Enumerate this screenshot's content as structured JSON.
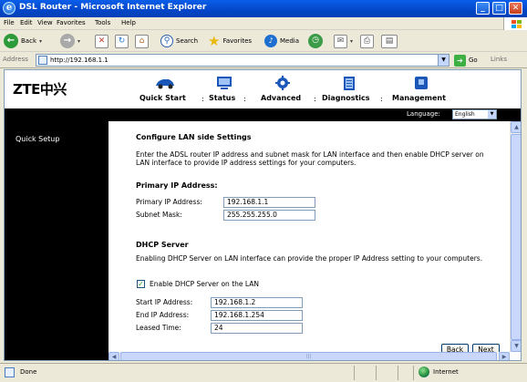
{
  "window": {
    "title": "DSL Router - Microsoft Internet Explorer"
  },
  "menu": [
    "File",
    "Edit",
    "View",
    "Favorites",
    "Tools",
    "Help"
  ],
  "toolbar": {
    "back": "Back",
    "search": "Search",
    "favorites": "Favorites",
    "media": "Media"
  },
  "address": {
    "label": "Address",
    "url": "http://192.168.1.1",
    "go": "Go",
    "links": "Links"
  },
  "header": {
    "logo": "ZTE中兴",
    "nav": [
      "Quick Start",
      "Status",
      "Advanced",
      "Diagnostics",
      "Management"
    ],
    "separator": ":"
  },
  "language": {
    "label": "Language:",
    "value": "English"
  },
  "sidebar": {
    "items": [
      "Quick Setup"
    ]
  },
  "lan": {
    "heading": "Configure LAN side Settings",
    "description": "Enter the ADSL router IP address and subnet mask for LAN interface and then enable DHCP server on LAN interface to provide IP address settings for your computers.",
    "primary_heading": "Primary IP Address:",
    "ip_label": "Primary IP Address:",
    "ip_value": "192.168.1.1",
    "mask_label": "Subnet Mask:",
    "mask_value": "255.255.255.0"
  },
  "dhcp": {
    "heading": "DHCP Server",
    "description": "Enabling DHCP Server on LAN interface can provide the proper IP Address setting to your computers.",
    "enable_label": "Enable DHCP Server on the LAN",
    "enabled": true,
    "start_label": "Start IP Address:",
    "start_value": "192.168.1.2",
    "end_label": "End IP Address:",
    "end_value": "192.168.1.254",
    "lease_label": "Leased Time:",
    "lease_value": "24"
  },
  "buttons": {
    "back": "Back",
    "next": "Next"
  },
  "status": {
    "text": "Done",
    "zone": "Internet"
  }
}
